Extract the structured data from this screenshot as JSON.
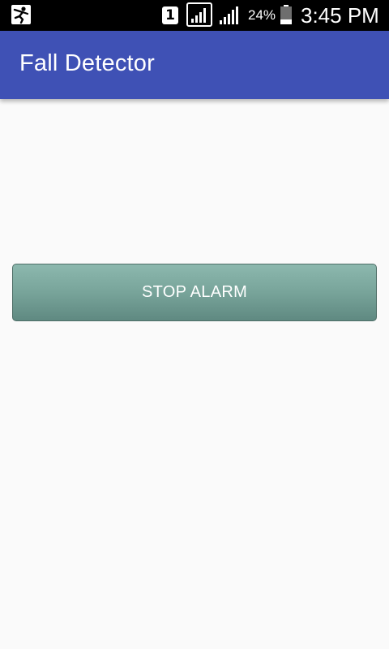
{
  "status_bar": {
    "app_notification_icon": "falling-person-icon",
    "sim_slot": "1",
    "signal_icons": [
      "signal-strength-boxed-icon",
      "signal-strength-icon"
    ],
    "battery_percent": "24%",
    "battery_icon": "battery-icon",
    "time": "3:45 PM"
  },
  "app_bar": {
    "title": "Fall Detector",
    "color": "#3f51b5"
  },
  "main": {
    "stop_button_label": "STOP ALARM",
    "button_color": "#78a49a"
  }
}
